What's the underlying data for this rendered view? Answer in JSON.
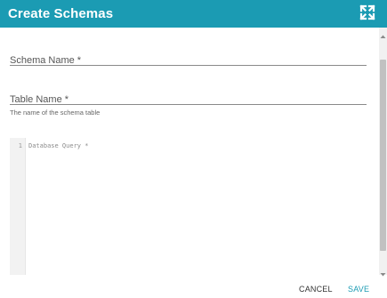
{
  "dialog": {
    "title": "Create Schemas",
    "expand_icon": "fullscreen-expand-icon"
  },
  "form": {
    "schema_name": {
      "label": "Schema Name *",
      "value": ""
    },
    "table_name": {
      "label": "Table Name *",
      "value": "",
      "hint": "The name of the schema table"
    },
    "database_query": {
      "line_number": "1",
      "placeholder": "Database Query *",
      "value": ""
    }
  },
  "actions": {
    "cancel_label": "CANCEL",
    "save_label": "SAVE"
  },
  "colors": {
    "header": "#1b9bb3",
    "save_accent": "#1b9bb3"
  }
}
